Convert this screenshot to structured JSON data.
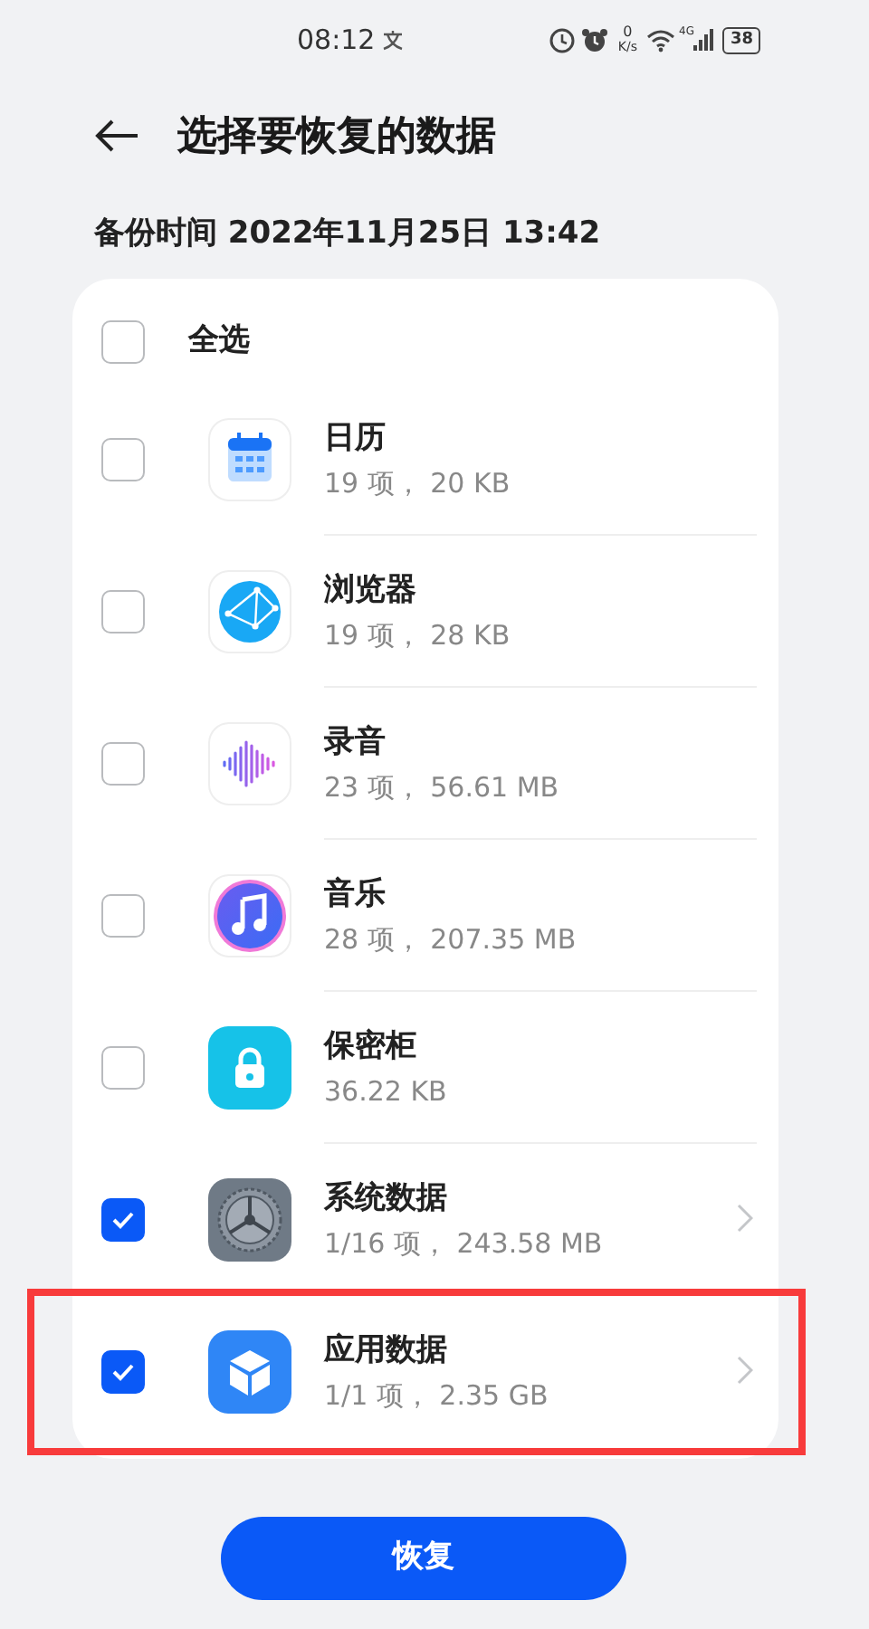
{
  "status_bar": {
    "time": "08:12",
    "speed_value": "0",
    "speed_unit": "K/s",
    "network": "4G",
    "battery": "38"
  },
  "header": {
    "title": "选择要恢复的数据"
  },
  "backup_time": "备份时间 2022年11月25日 13:42",
  "select_all": {
    "label": "全选",
    "checked": false
  },
  "items": [
    {
      "name": "日历",
      "detail": "19 项， 20 KB",
      "checked": false,
      "expandable": false,
      "highlighted": false
    },
    {
      "name": "浏览器",
      "detail": "19 项， 28 KB",
      "checked": false,
      "expandable": false,
      "highlighted": false
    },
    {
      "name": "录音",
      "detail": "23 项， 56.61 MB",
      "checked": false,
      "expandable": false,
      "highlighted": false
    },
    {
      "name": "音乐",
      "detail": "28 项， 207.35 MB",
      "checked": false,
      "expandable": false,
      "highlighted": false
    },
    {
      "name": "保密柜",
      "detail": "36.22 KB",
      "checked": false,
      "expandable": false,
      "highlighted": false
    },
    {
      "name": "系统数据",
      "detail": "1/16 项， 243.58 MB",
      "checked": true,
      "expandable": true,
      "highlighted": false
    },
    {
      "name": "应用数据",
      "detail": "1/1 项， 2.35 GB",
      "checked": true,
      "expandable": true,
      "highlighted": true
    }
  ],
  "restore_button": "恢复"
}
